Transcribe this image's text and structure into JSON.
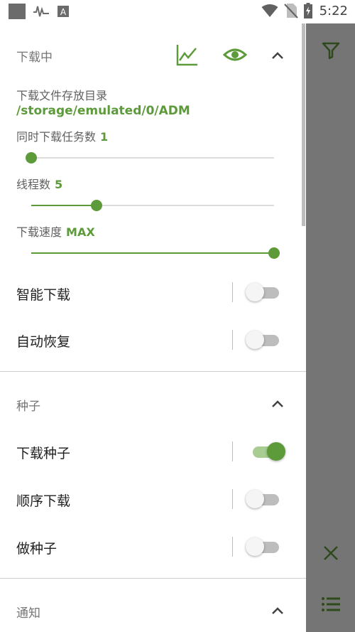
{
  "status_bar": {
    "time": "5:22",
    "icons": [
      "app-square-icon",
      "activity-icon",
      "a-box-icon",
      "wifi-icon",
      "no-sim-icon",
      "battery-charging-icon"
    ]
  },
  "colors": {
    "accent": "#5d9b3a",
    "sidebar": "#757575",
    "sidebar_icon": "#2e4a1c"
  },
  "downloading": {
    "title": "下载中",
    "icons": [
      "chart-icon",
      "eye-icon",
      "chevron-up-icon"
    ],
    "dir_label": "下载文件存放目录",
    "dir_path": "/storage/emulated/0/ADM",
    "tasks_label": "同时下载任务数",
    "tasks_value": "1",
    "threads_label": "线程数",
    "threads_value": "5",
    "speed_label": "下载速度",
    "speed_value": "MAX",
    "tasks_slider_fraction": 0.0,
    "threads_slider_fraction": 0.27,
    "speed_slider_fraction": 1.0,
    "smart_download_label": "智能下载",
    "smart_download_on": false,
    "auto_resume_label": "自动恢复",
    "auto_resume_on": false
  },
  "torrent": {
    "title": "种子",
    "download_torrent_label": "下载种子",
    "download_torrent_on": true,
    "sequential_label": "顺序下载",
    "sequential_on": false,
    "seeding_label": "做种子",
    "seeding_on": false
  },
  "notification": {
    "title": "通知"
  },
  "sidebar": {
    "icons": [
      "filter-icon",
      "close-icon",
      "list-icon"
    ]
  }
}
